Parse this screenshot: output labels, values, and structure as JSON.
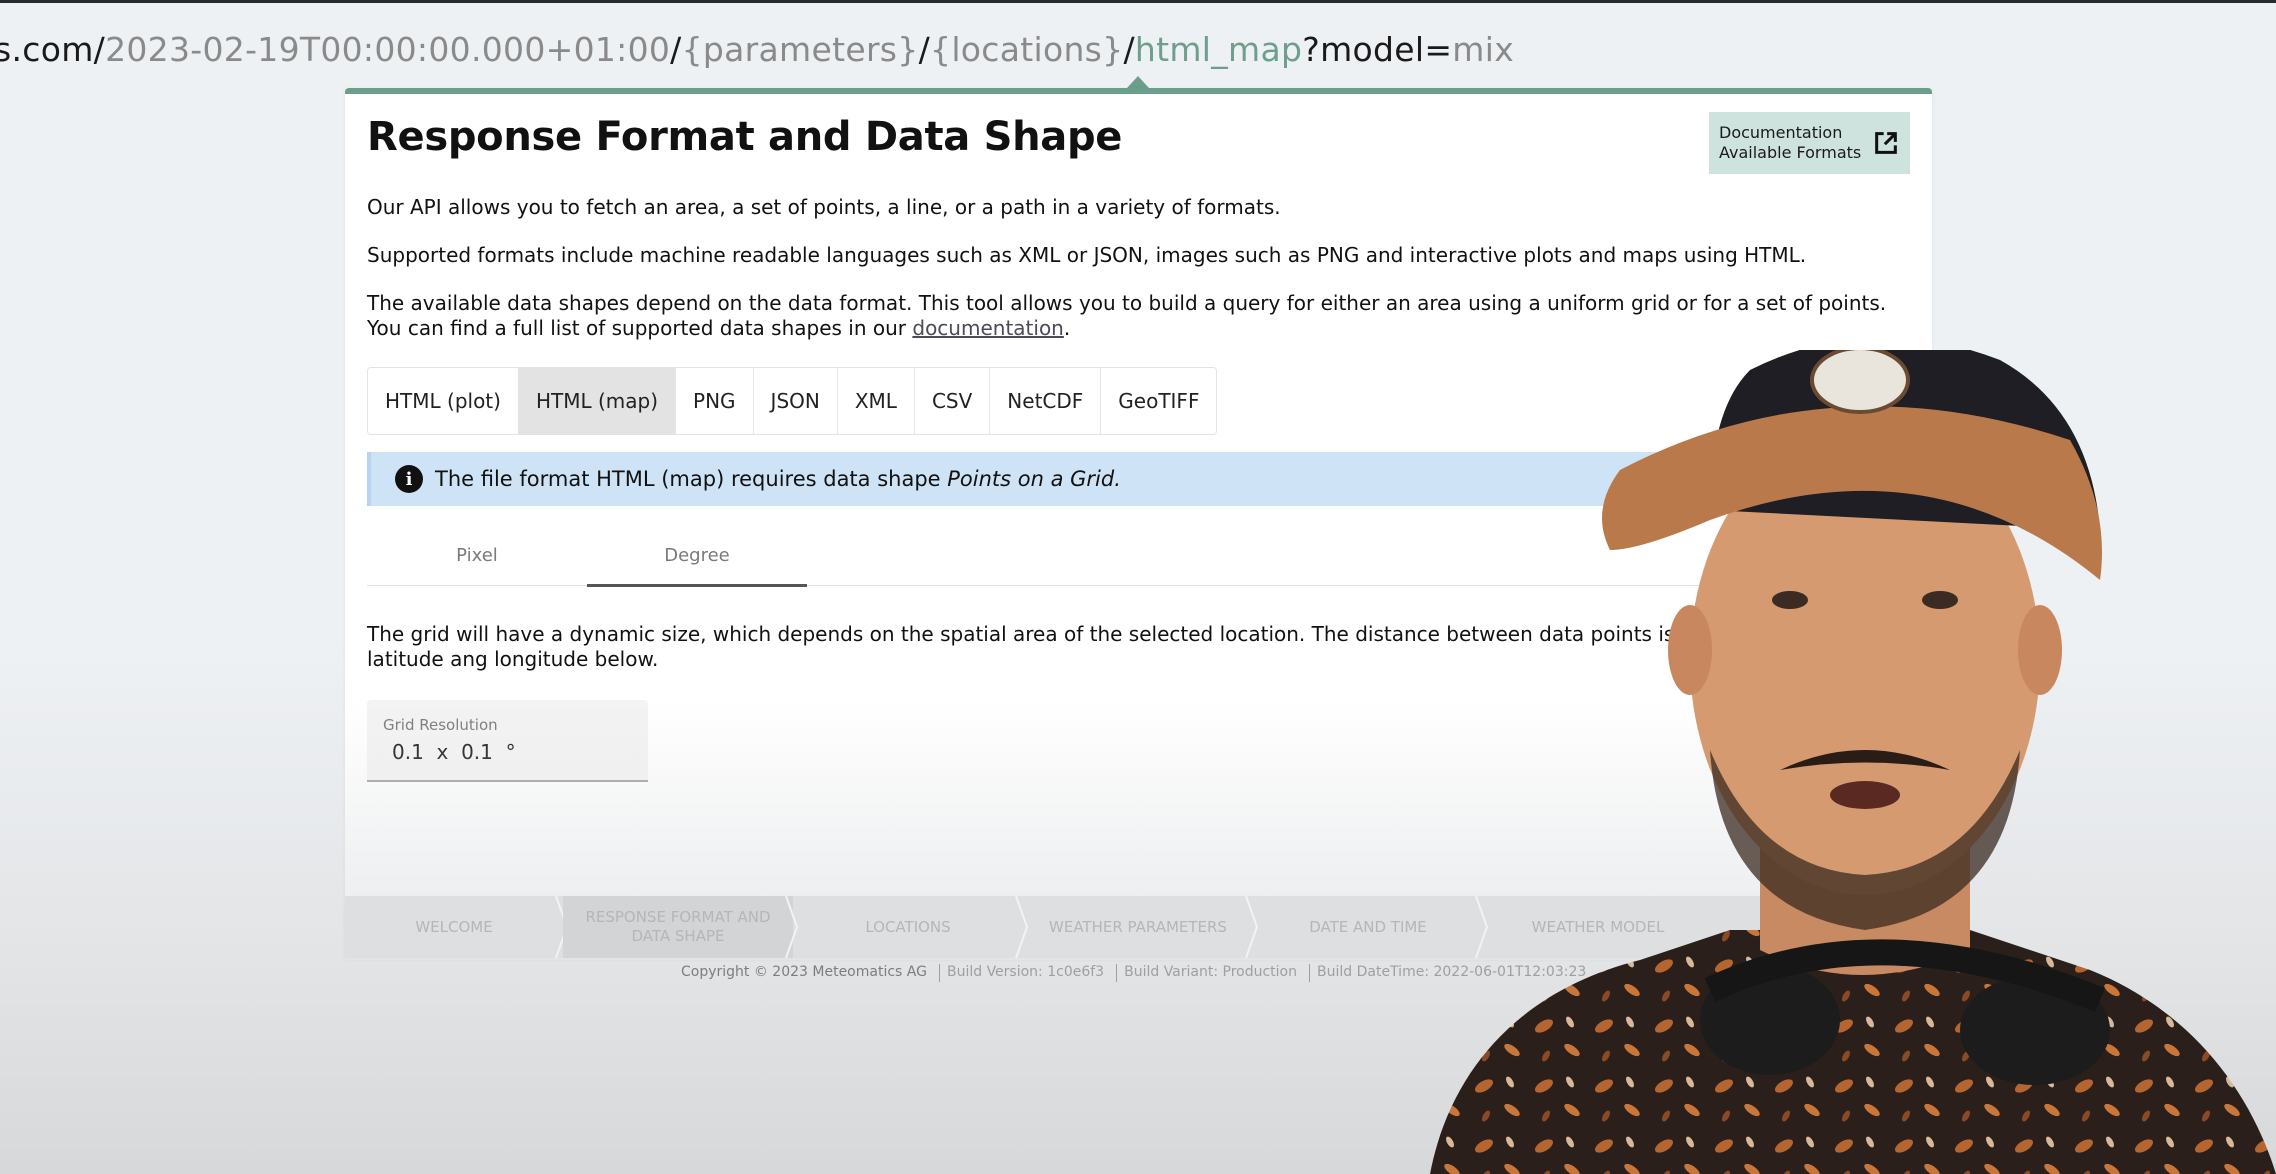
{
  "url": {
    "prefix": "s.com/",
    "datetime": "2023-02-19T00:00:00.000+01:00",
    "sep1": "/",
    "parameters": "{parameters}",
    "sep2": "/",
    "locations": "{locations}",
    "sep3": "/",
    "format": "html_map",
    "query_key": "?model=",
    "query_value": "mix"
  },
  "card": {
    "title": "Response Format and Data Shape",
    "doc_button": {
      "line1": "Documentation",
      "line2": "Available Formats",
      "icon": "external-link-icon"
    },
    "paragraphs": {
      "p1": "Our API allows you to fetch an area, a set of points, a line, or a path in a variety of formats.",
      "p2": "Supported formats include machine readable languages such as XML or JSON, images such as PNG and interactive plots and maps using HTML.",
      "p3_text": "The available data shapes depend on the data format. This tool allows you to build a query for either an area using a uniform grid or for a set of points. You can find a full list of supported data shapes in our ",
      "p3_link": "documentation",
      "p3_end": "."
    },
    "format_tabs": [
      {
        "label": "HTML (plot)",
        "active": false
      },
      {
        "label": "HTML (map)",
        "active": true
      },
      {
        "label": "PNG",
        "active": false
      },
      {
        "label": "JSON",
        "active": false
      },
      {
        "label": "XML",
        "active": false
      },
      {
        "label": "CSV",
        "active": false
      },
      {
        "label": "NetCDF",
        "active": false
      },
      {
        "label": "GeoTIFF",
        "active": false
      }
    ],
    "alert": {
      "icon": "info-icon",
      "text": "The file format HTML (map) requires data shape ",
      "emphasis": "Points on a Grid."
    },
    "unit_tabs": [
      {
        "label": "Pixel",
        "active": false
      },
      {
        "label": "Degree",
        "active": true
      }
    ],
    "grid_description": "The grid will have a dynamic size, which depends on the spatial area of the selected location. The distance between data points is given by the degree latitude ang longitude below.",
    "grid_field": {
      "label": "Grid Resolution",
      "value": "0.1  x  0.1  °"
    }
  },
  "stepper": [
    {
      "label": "WELCOME",
      "active": false
    },
    {
      "label": "RESPONSE FORMAT AND DATA SHAPE",
      "active": true
    },
    {
      "label": "LOCATIONS",
      "active": false
    },
    {
      "label": "WEATHER PARAMETERS",
      "active": false
    },
    {
      "label": "DATE AND TIME",
      "active": false
    },
    {
      "label": "WEATHER MODEL",
      "active": false
    }
  ],
  "footer": {
    "copyright": "Copyright © 2023 Meteomatics AG",
    "build_version": "Build Version: 1c0e6f3",
    "build_variant": "Build Variant: Production",
    "build_datetime": "Build DateTime: 2022-06-01T12:03:23"
  },
  "colors": {
    "accent_green": "#6c9e8c",
    "doc_button_bg": "#cfe3de",
    "alert_bg": "#cfe3f7"
  }
}
